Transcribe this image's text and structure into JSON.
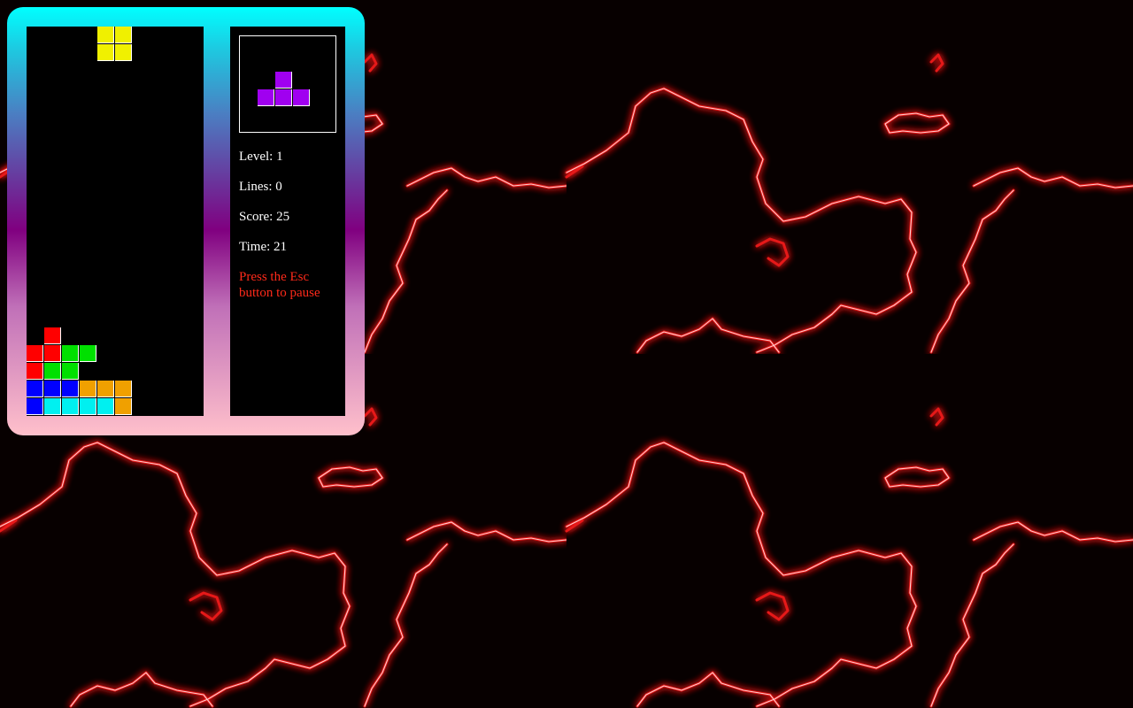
{
  "stats": {
    "level_label": "Level:",
    "level": "1",
    "lines_label": "Lines:",
    "lines": "0",
    "score_label": "Score:",
    "score": "25",
    "time_label": "Time:",
    "time": "21"
  },
  "hint": "Press the Esc button to pause",
  "board": {
    "columns": 10,
    "rows": 22,
    "falling_piece": {
      "type": "O",
      "color": "#f0f000",
      "cells": [
        [
          4,
          0
        ],
        [
          5,
          0
        ],
        [
          4,
          1
        ],
        [
          5,
          1
        ]
      ]
    },
    "locked_cells": [
      {
        "col": 1,
        "row": 17,
        "color": "#ff0000"
      },
      {
        "col": 0,
        "row": 18,
        "color": "#ff0000"
      },
      {
        "col": 1,
        "row": 18,
        "color": "#ff0000"
      },
      {
        "col": 2,
        "row": 18,
        "color": "#00e000"
      },
      {
        "col": 3,
        "row": 18,
        "color": "#00e000"
      },
      {
        "col": 0,
        "row": 19,
        "color": "#ff0000"
      },
      {
        "col": 1,
        "row": 19,
        "color": "#00e000"
      },
      {
        "col": 2,
        "row": 19,
        "color": "#00e000"
      },
      {
        "col": 0,
        "row": 20,
        "color": "#0000ff"
      },
      {
        "col": 1,
        "row": 20,
        "color": "#0000ff"
      },
      {
        "col": 2,
        "row": 20,
        "color": "#0000ff"
      },
      {
        "col": 3,
        "row": 20,
        "color": "#f0a000"
      },
      {
        "col": 4,
        "row": 20,
        "color": "#f0a000"
      },
      {
        "col": 5,
        "row": 20,
        "color": "#f0a000"
      },
      {
        "col": 0,
        "row": 21,
        "color": "#0000ff"
      },
      {
        "col": 1,
        "row": 21,
        "color": "#00f0f0"
      },
      {
        "col": 2,
        "row": 21,
        "color": "#00f0f0"
      },
      {
        "col": 3,
        "row": 21,
        "color": "#00f0f0"
      },
      {
        "col": 4,
        "row": 21,
        "color": "#00f0f0"
      },
      {
        "col": 5,
        "row": 21,
        "color": "#f0a000"
      }
    ]
  },
  "next_piece": {
    "type": "T",
    "color": "#a000f0",
    "cells": [
      [
        1,
        0
      ],
      [
        0,
        1
      ],
      [
        1,
        1
      ],
      [
        2,
        1
      ]
    ]
  },
  "colors": {
    "frame_top": "#00ffff",
    "frame_middle": "#800080",
    "frame_bottom": "#ffc0cb",
    "lightning": "#ff2020",
    "hint_text": "#ff2a1a"
  }
}
